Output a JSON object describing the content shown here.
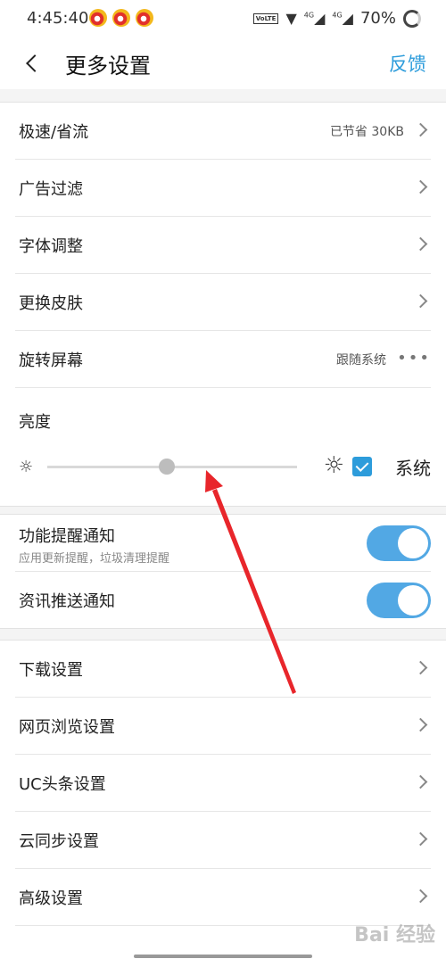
{
  "status_bar": {
    "time": "4:45:40",
    "volte": "VoLTE",
    "net1": "4G",
    "net2": "4G",
    "battery": "70%"
  },
  "header": {
    "title": "更多设置",
    "feedback": "反馈"
  },
  "group1": {
    "speed_mode": {
      "label": "极速/省流",
      "value": "已节省 30KB"
    },
    "ad_filter": {
      "label": "广告过滤"
    },
    "font_adjust": {
      "label": "字体调整"
    },
    "skin": {
      "label": "更换皮肤"
    },
    "rotate": {
      "label": "旋转屏幕",
      "value": "跟随系统"
    },
    "brightness": {
      "label": "亮度",
      "level": 0.48,
      "system_label": "系统",
      "system_checked": true
    }
  },
  "group2": {
    "feature_notify": {
      "label": "功能提醒通知",
      "sub": "应用更新提醒，垃圾清理提醒",
      "on": true
    },
    "news_notify": {
      "label": "资讯推送通知",
      "on": true
    }
  },
  "group3": {
    "download": {
      "label": "下载设置"
    },
    "browse": {
      "label": "网页浏览设置"
    },
    "uc_headlines": {
      "label": "UC头条设置"
    },
    "cloud_sync": {
      "label": "云同步设置"
    },
    "advanced": {
      "label": "高级设置"
    }
  },
  "watermark": "Bai 经验",
  "colors": {
    "accent": "#2d9cdb",
    "toggle": "#52a8e4",
    "arrow": "#e8262b"
  }
}
